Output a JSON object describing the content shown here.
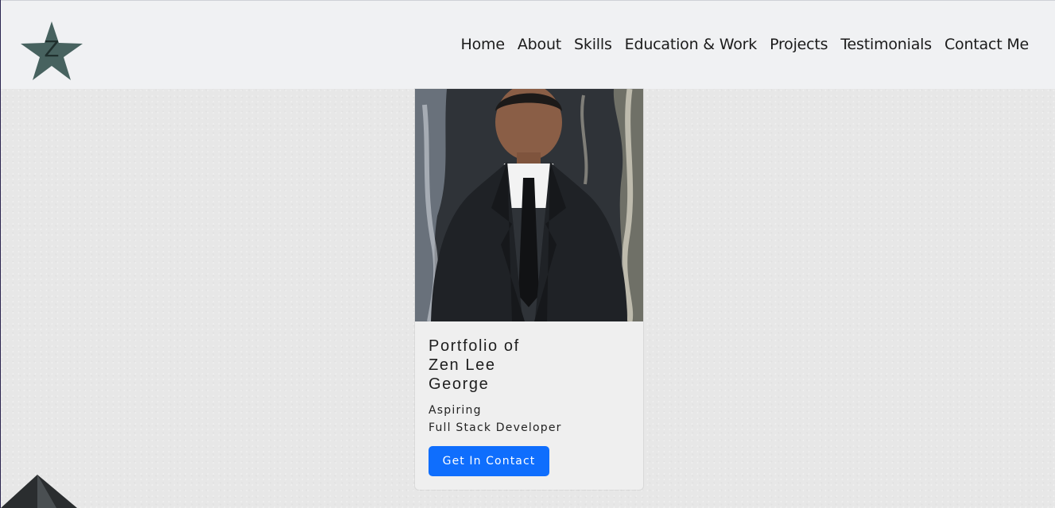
{
  "logo": {
    "letter": "Z",
    "icon": "star-logo-icon",
    "color": "#47625f"
  },
  "nav": {
    "items": [
      {
        "label": "Home"
      },
      {
        "label": "About"
      },
      {
        "label": "Skills"
      },
      {
        "label": "Education & Work"
      },
      {
        "label": "Projects"
      },
      {
        "label": "Testimonials"
      },
      {
        "label": "Contact Me"
      }
    ]
  },
  "hero": {
    "photo_icon": "portrait-photo",
    "title_lines": [
      "Portfolio of",
      "Zen Lee",
      "George"
    ],
    "subtitle_lines": [
      "Aspiring",
      "Full Stack Developer"
    ],
    "button_label": "Get In Contact",
    "button_color": "#0f6efd"
  },
  "decor": {
    "corner_icon": "triangle-decor-icon"
  }
}
